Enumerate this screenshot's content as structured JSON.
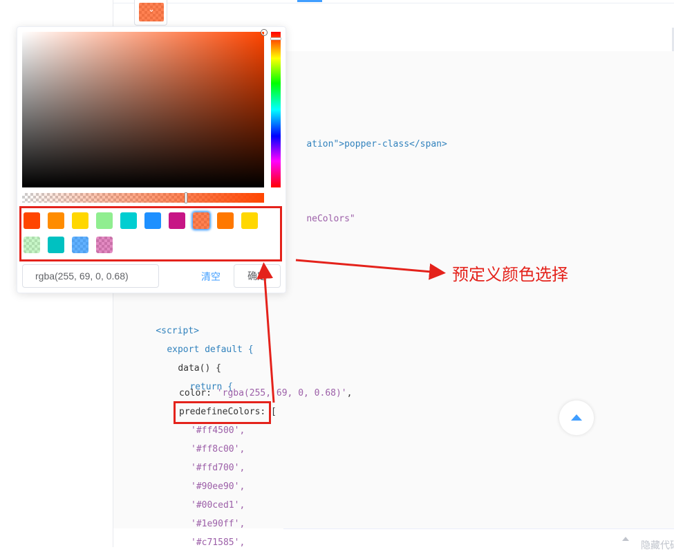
{
  "colors": {
    "accent": "#409eff",
    "annotation": "#e4221b",
    "selected_color": "#ff4500",
    "selected_alpha": 0.68
  },
  "footer": {
    "hide_code_label": "隐藏代码"
  },
  "code": {
    "line_attr_fragment": "ation\">popper-class</span>",
    "line_predefine_fragment": "neColors\"",
    "script_open": "<script>",
    "export_default": "export default {",
    "data_fn": "data() {",
    "return_kw": "return {",
    "color_key": "color: ",
    "color_value": "'rgba(255, 69, 0, 0.68)'",
    "color_comma": ",",
    "predefine_key": "predefineColors",
    "predefine_open": ": [",
    "predefine_values": [
      "'#ff4500',",
      "'#ff8c00',",
      "'#ffd700',",
      "'#90ee90',",
      "'#00ced1',",
      "'#1e90ff',",
      "'#c71585',"
    ]
  },
  "color_picker": {
    "predefine_colors": [
      "#ff4500",
      "#ff8c00",
      "#ffd700",
      "#90ee90",
      "#00ced1",
      "#1e90ff",
      "#c71585",
      "rgba(255,69,0,0.68)",
      "#ff7800",
      "#ffd700",
      "rgba(144,238,144,0.5)",
      "#00c1c1",
      "rgba(30,144,255,0.7)",
      "rgba(199,21,133,0.5)"
    ],
    "selected_index": 7,
    "input_value": "rgba(255, 69, 0, 0.68)",
    "clear_label": "清空",
    "confirm_label": "确定"
  },
  "annotation": {
    "label": "预定义颜色选择"
  },
  "icons": {
    "trigger_arrow": "chevron-down-icon",
    "backtop": "caret-up-icon"
  }
}
